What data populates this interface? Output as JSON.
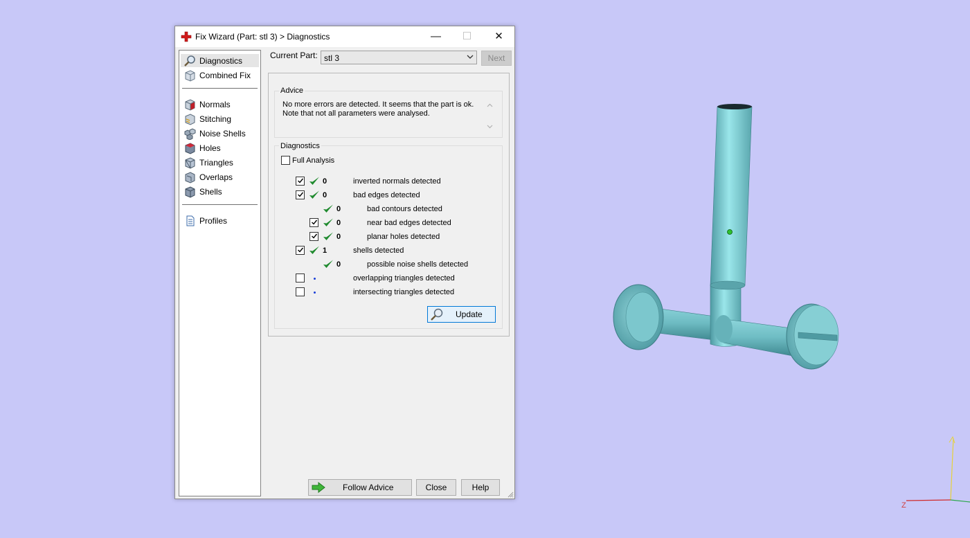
{
  "window": {
    "title": "Fix Wizard (Part: stl 3) > Diagnostics",
    "minimize": "—",
    "maximize": "☐",
    "close": "✕"
  },
  "sidebar": {
    "items": [
      {
        "label": "Diagnostics",
        "icon": "magnifier-icon",
        "selected": true
      },
      {
        "label": "Combined Fix",
        "icon": "cube-icon"
      },
      {
        "label": "Normals",
        "icon": "normals-cube-icon"
      },
      {
        "label": "Stitching",
        "icon": "stitching-cube-icon"
      },
      {
        "label": "Noise Shells",
        "icon": "noise-shells-icon"
      },
      {
        "label": "Holes",
        "icon": "holes-cube-icon"
      },
      {
        "label": "Triangles",
        "icon": "triangles-cube-icon"
      },
      {
        "label": "Overlaps",
        "icon": "overlaps-cube-icon"
      },
      {
        "label": "Shells",
        "icon": "shells-cube-icon"
      },
      {
        "label": "Profiles",
        "icon": "document-icon"
      }
    ]
  },
  "header": {
    "current_part_label": "Current Part:",
    "current_part_value": "stl 3",
    "next_label": "Next"
  },
  "advice": {
    "title": "Advice",
    "text": "No more errors are detected. It seems that the part is ok. Note that not all parameters were analysed."
  },
  "diagnostics": {
    "title": "Diagnostics",
    "full_analysis_label": "Full Analysis",
    "full_analysis_checked": false,
    "rows": [
      {
        "checkbox": true,
        "checked": true,
        "status": "ok",
        "count": "0",
        "label": "inverted normals detected",
        "indent": 0
      },
      {
        "checkbox": true,
        "checked": true,
        "status": "ok",
        "count": "0",
        "label": "bad edges detected",
        "indent": 0
      },
      {
        "checkbox": false,
        "checked": false,
        "status": "ok",
        "count": "0",
        "label": "bad contours detected",
        "indent": 1
      },
      {
        "checkbox": true,
        "checked": true,
        "status": "ok",
        "count": "0",
        "label": "near bad edges detected",
        "indent": 1
      },
      {
        "checkbox": true,
        "checked": true,
        "status": "ok",
        "count": "0",
        "label": "planar holes detected",
        "indent": 1
      },
      {
        "checkbox": true,
        "checked": true,
        "status": "ok",
        "count": "1",
        "label": "shells detected",
        "indent": 0
      },
      {
        "checkbox": false,
        "checked": false,
        "status": "ok",
        "count": "0",
        "label": "possible noise shells detected",
        "indent": 1
      },
      {
        "checkbox": true,
        "checked": false,
        "status": "unknown",
        "count": "",
        "label": "overlapping triangles detected",
        "indent": 0
      },
      {
        "checkbox": true,
        "checked": false,
        "status": "unknown",
        "count": "",
        "label": "intersecting triangles detected",
        "indent": 0
      }
    ],
    "update_label": "Update"
  },
  "footer": {
    "follow_advice_label": "Follow Advice",
    "close_label": "Close",
    "help_label": "Help"
  },
  "viewport": {
    "axis_label_z": "Z",
    "axis_label_y": "Y",
    "model_color": "#7fc9cf",
    "background": "#c8c8f8"
  }
}
